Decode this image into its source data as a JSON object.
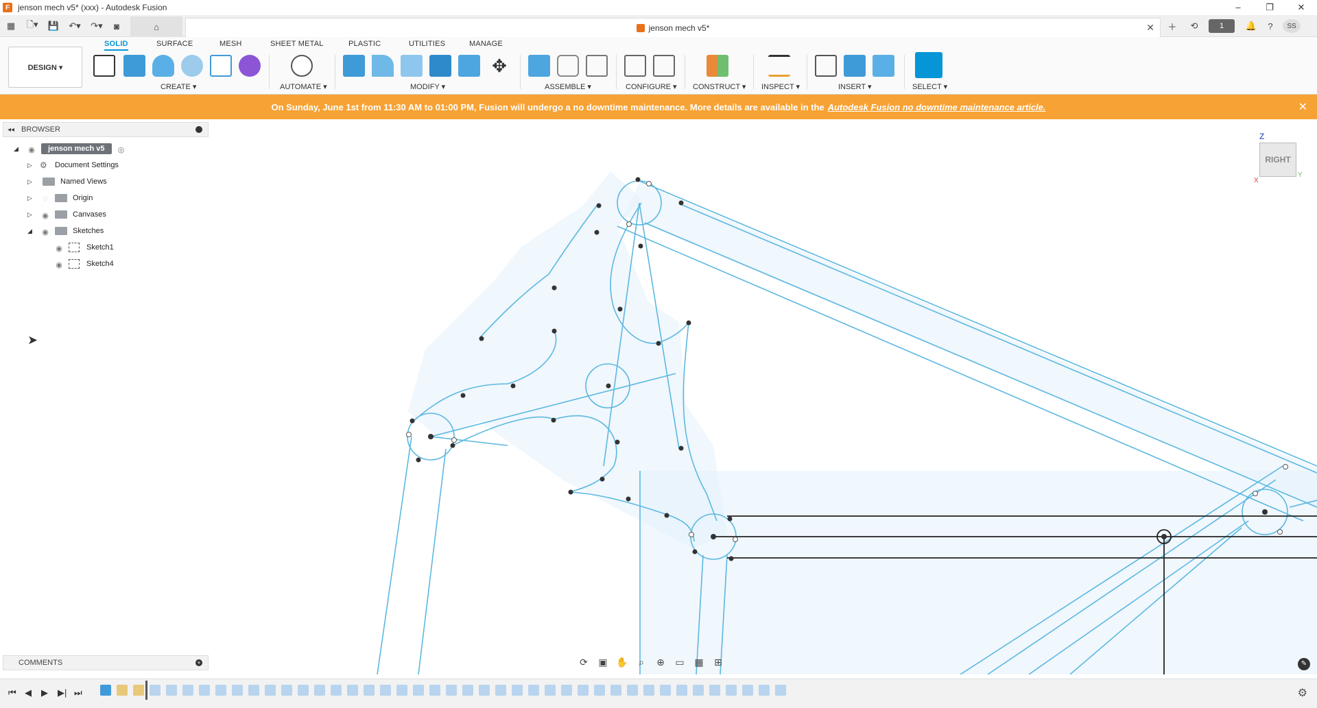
{
  "window": {
    "title": "jenson mech v5* (xxx) - Autodesk Fusion",
    "controls": [
      "–",
      "❐",
      "✕"
    ]
  },
  "qat": {
    "doc_tab_title": "jenson mech v5*",
    "job_count": "1",
    "user_initials": "SS"
  },
  "ribbon": {
    "workspace": "DESIGN ▾",
    "tabs": [
      "SOLID",
      "SURFACE",
      "MESH",
      "SHEET METAL",
      "PLASTIC",
      "UTILITIES",
      "MANAGE"
    ],
    "active_tab": "SOLID",
    "groups": [
      "CREATE ▾",
      "AUTOMATE ▾",
      "MODIFY ▾",
      "ASSEMBLE ▾",
      "CONFIGURE ▾",
      "CONSTRUCT ▾",
      "INSPECT ▾",
      "INSERT ▾",
      "SELECT ▾"
    ]
  },
  "banner": {
    "text": "On Sunday, June 1st from 11:30 AM to 01:00 PM, Fusion will undergo a no downtime maintenance. More details are available in the",
    "link": "Autodesk Fusion no downtime maintenance article."
  },
  "browser": {
    "title": "BROWSER",
    "root": "jenson mech v5",
    "items": [
      {
        "label": "Document Settings"
      },
      {
        "label": "Named Views"
      },
      {
        "label": "Origin"
      },
      {
        "label": "Canvases"
      },
      {
        "label": "Sketches"
      },
      {
        "label": "Sketch1"
      },
      {
        "label": "Sketch4"
      }
    ]
  },
  "comments": {
    "title": "COMMENTS"
  },
  "viewcube": {
    "face": "RIGHT",
    "z": "Z",
    "y": "Y",
    "x": "X"
  },
  "colors": {
    "accent": "#0696d7",
    "banner": "#f7a234",
    "sketch_line": "#5bb8e0",
    "sketch_fill": "#d8ecf8"
  }
}
